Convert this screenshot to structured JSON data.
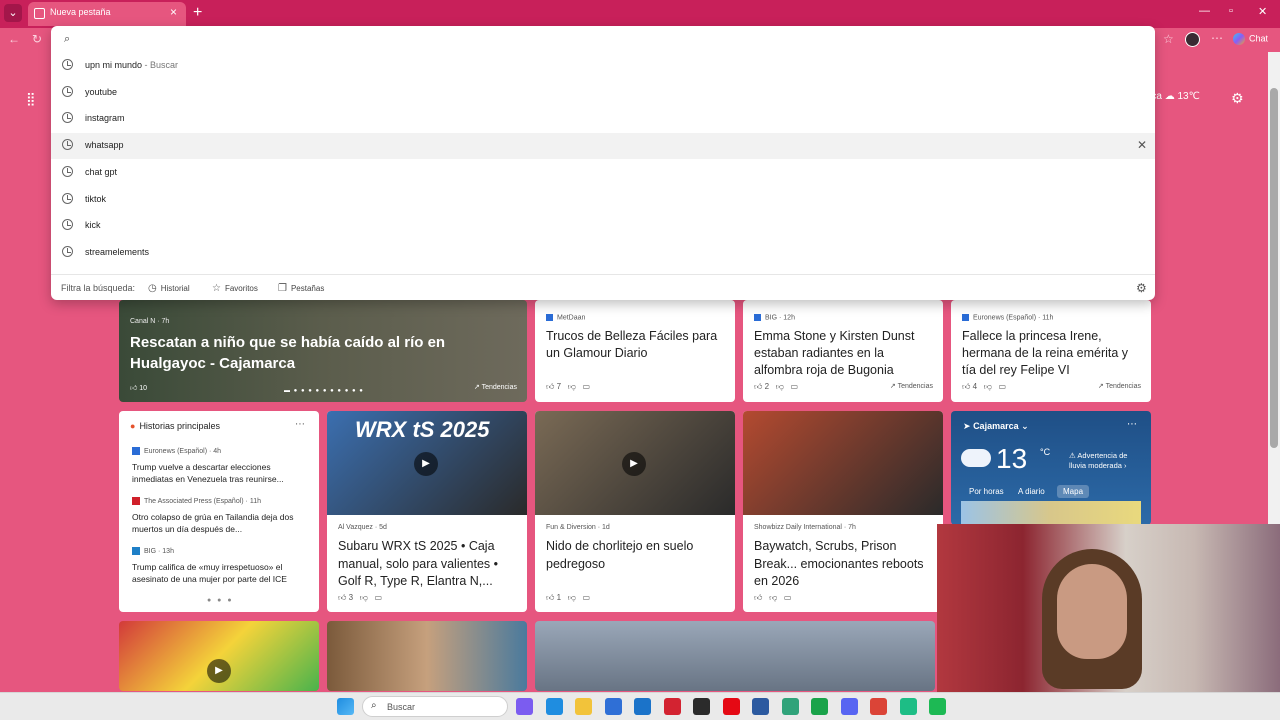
{
  "browser": {
    "tab_title": "Nueva pestaña",
    "chat_label": "Chat"
  },
  "omnibox": {
    "placeholder": "",
    "suggestions": [
      {
        "text": "upn mi mundo",
        "hint": " - Buscar"
      },
      {
        "text": "youtube",
        "hint": ""
      },
      {
        "text": "instagram",
        "hint": ""
      },
      {
        "text": "whatsapp",
        "hint": ""
      },
      {
        "text": "chat gpt",
        "hint": ""
      },
      {
        "text": "tiktok",
        "hint": ""
      },
      {
        "text": "kick",
        "hint": ""
      },
      {
        "text": "streamelements",
        "hint": ""
      }
    ],
    "filter_label": "Filtra la búsqueda:",
    "filters": [
      "Historial",
      "Favoritos",
      "Pestañas"
    ]
  },
  "header": {
    "weather_temp": "13℃",
    "weather_location_partial": "rca"
  },
  "feed": {
    "hero": {
      "source": "Canal N · 7h",
      "title": "Rescatan a niño que se había caído al río en Hualgayoc - Cajamarca",
      "likes": "10",
      "trend": "Tendencias"
    },
    "cards": [
      {
        "source": "MetDaan",
        "title": "Trucos de Belleza Fáciles para un Glamour Diario",
        "likes": "7",
        "trend": ""
      },
      {
        "source": "BIG · 12h",
        "title": "Emma Stone y Kirsten Dunst estaban radiantes en la alfombra roja de Bugonia",
        "likes": "2",
        "trend": "Tendencias"
      },
      {
        "source": "Euronews (Español) · 11h",
        "title": "Fallece la princesa Irene, hermana de la reina emérita y tía del rey Felipe VI",
        "likes": "4",
        "trend": "Tendencias"
      }
    ],
    "top_stories": {
      "heading": "Historias principales",
      "items": [
        {
          "source": "Euronews (Español) · 4h",
          "title": "Trump vuelve a descartar elecciones inmediatas en Venezuela tras reunirse...",
          "color": "#2a6cd6"
        },
        {
          "source": "The Associated Press (Español) · 11h",
          "title": "Otro colapso de grúa en Tailandia deja dos muertos un día después de...",
          "color": "#d0202a"
        },
        {
          "source": "BIG · 13h",
          "title": "Trump califica de «muy irrespetuoso» el asesinato de una mujer por parte del ICE",
          "color": "#1e7fc7"
        }
      ]
    },
    "videos": [
      {
        "source": "Al Vazquez · 5d",
        "title": "Subaru WRX tS 2025 • Caja manual, solo para valientes • Golf R, Type R, Elantra N,...",
        "likes": "3",
        "overlay": "WRX tS 2025",
        "color": "#3b6fb0"
      },
      {
        "source": "Fun & Diversion · 1d",
        "title": "Nido de chorlitejo en suelo pedregoso",
        "likes": "1",
        "overlay": "",
        "color": "#7a6a55"
      },
      {
        "source": "Showbizz Daily International · 7h",
        "title": "Baywatch, Scrubs, Prison Break... emocionantes reboots en 2026",
        "likes": "",
        "overlay": "",
        "color": "#b44a30"
      }
    ],
    "weather": {
      "location": "Cajamarca",
      "temp": "13",
      "unit": "°C",
      "alert": "Advertencia de lluvia moderada",
      "tabs": [
        "Por horas",
        "A diario",
        "Mapa"
      ],
      "selected_tab": "Mapa"
    }
  },
  "taskbar": {
    "search_placeholder": "Buscar",
    "apps": [
      {
        "name": "copilot",
        "color": "#7b5cf0"
      },
      {
        "name": "edge",
        "color": "#1f8de0"
      },
      {
        "name": "file-explorer",
        "color": "#f2c33a"
      },
      {
        "name": "store",
        "color": "#2f6fd6"
      },
      {
        "name": "outlook",
        "color": "#1b73c9"
      },
      {
        "name": "opera",
        "color": "#d32331"
      },
      {
        "name": "app-dark",
        "color": "#2b2b2b"
      },
      {
        "name": "netflix",
        "color": "#e50914"
      },
      {
        "name": "capture",
        "color": "#2c5aa0"
      },
      {
        "name": "copilot-2",
        "color": "#30a37a"
      },
      {
        "name": "app-green",
        "color": "#1aa34a"
      },
      {
        "name": "discord",
        "color": "#5865f2"
      },
      {
        "name": "chrome",
        "color": "#db4437"
      },
      {
        "name": "app-teal",
        "color": "#1dbd85"
      },
      {
        "name": "spotify",
        "color": "#1db954"
      }
    ]
  }
}
